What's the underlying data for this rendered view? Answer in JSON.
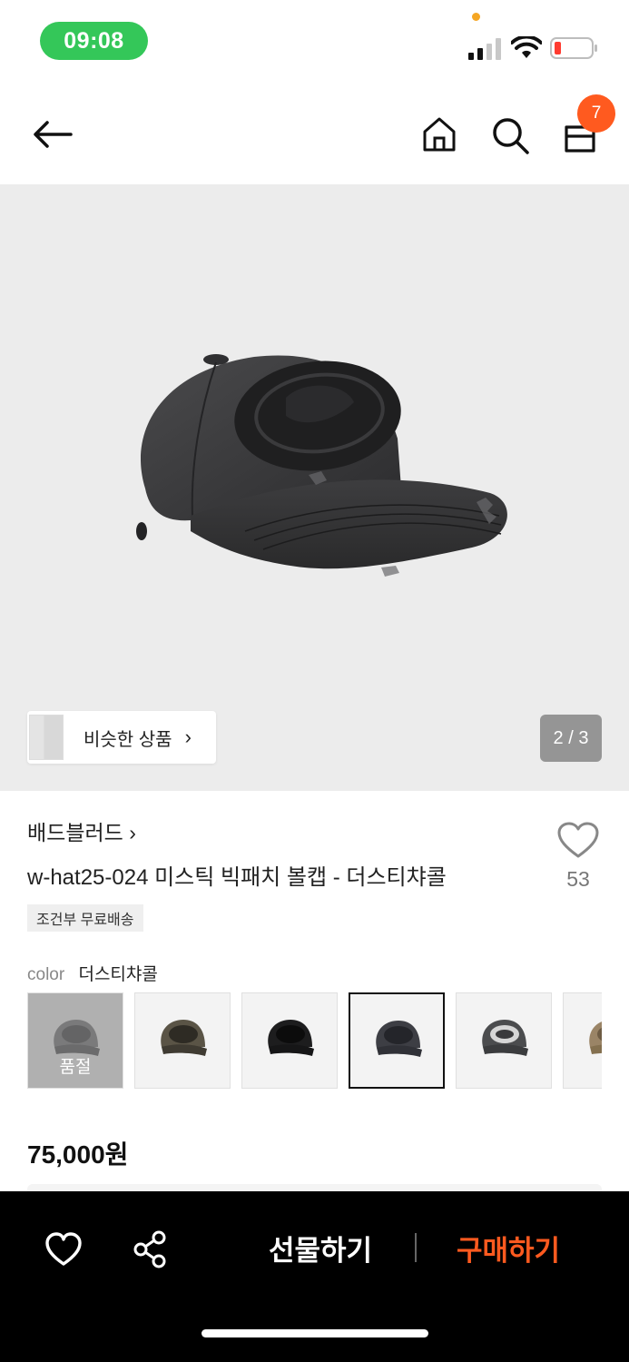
{
  "status_bar": {
    "time": "09:08"
  },
  "header": {
    "cart_count": "7"
  },
  "gallery": {
    "similar_label": "비슷한 상품",
    "page_indicator": "2 / 3"
  },
  "product": {
    "brand": "배드블러드 ›",
    "title": "w-hat25-024 미스틱 빅패치 볼캡 - 더스티챠콜",
    "like_count": "53",
    "shipping_tag": "조건부 무료배송",
    "color_label": "color",
    "color_value": "더스티챠콜",
    "swatches": [
      {
        "name": "grey",
        "soldout": true,
        "soldout_label": "품절"
      },
      {
        "name": "camo-brown",
        "soldout": false
      },
      {
        "name": "black",
        "soldout": false
      },
      {
        "name": "dusty-charcoal",
        "soldout": false,
        "selected": true
      },
      {
        "name": "charcoal-grey",
        "soldout": false
      },
      {
        "name": "beige",
        "soldout": false
      }
    ],
    "price": "75,000원"
  },
  "bottom_bar": {
    "gift_label": "선물하기",
    "buy_label": "구매하기"
  },
  "colors": {
    "accent": "#ff5a1f",
    "time_pill": "#34c759",
    "bottom_bar_bg": "#000000"
  }
}
